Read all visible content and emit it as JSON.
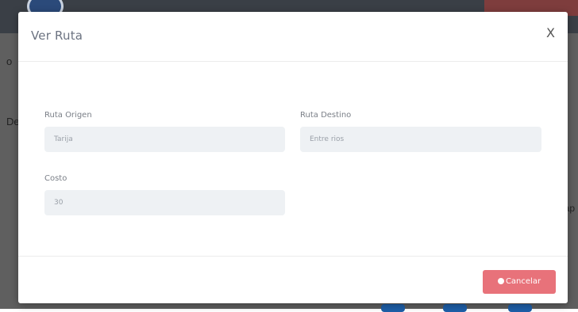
{
  "background": {
    "left_texts": [
      "o",
      "De"
    ],
    "right_texts": [
      "ap"
    ]
  },
  "modal": {
    "title": "Ver Ruta",
    "close_label": "X",
    "fields": {
      "origin": {
        "label": "Ruta Origen",
        "value": "Tarija"
      },
      "destination": {
        "label": "Ruta Destino",
        "value": "Entre rios"
      },
      "cost": {
        "label": "Costo",
        "value": "30"
      }
    },
    "cancel_label": "Cancelar"
  },
  "colors": {
    "cancel_button": "#e8727a",
    "input_background": "#eef1f4",
    "backdrop": "#5f5f5f"
  }
}
